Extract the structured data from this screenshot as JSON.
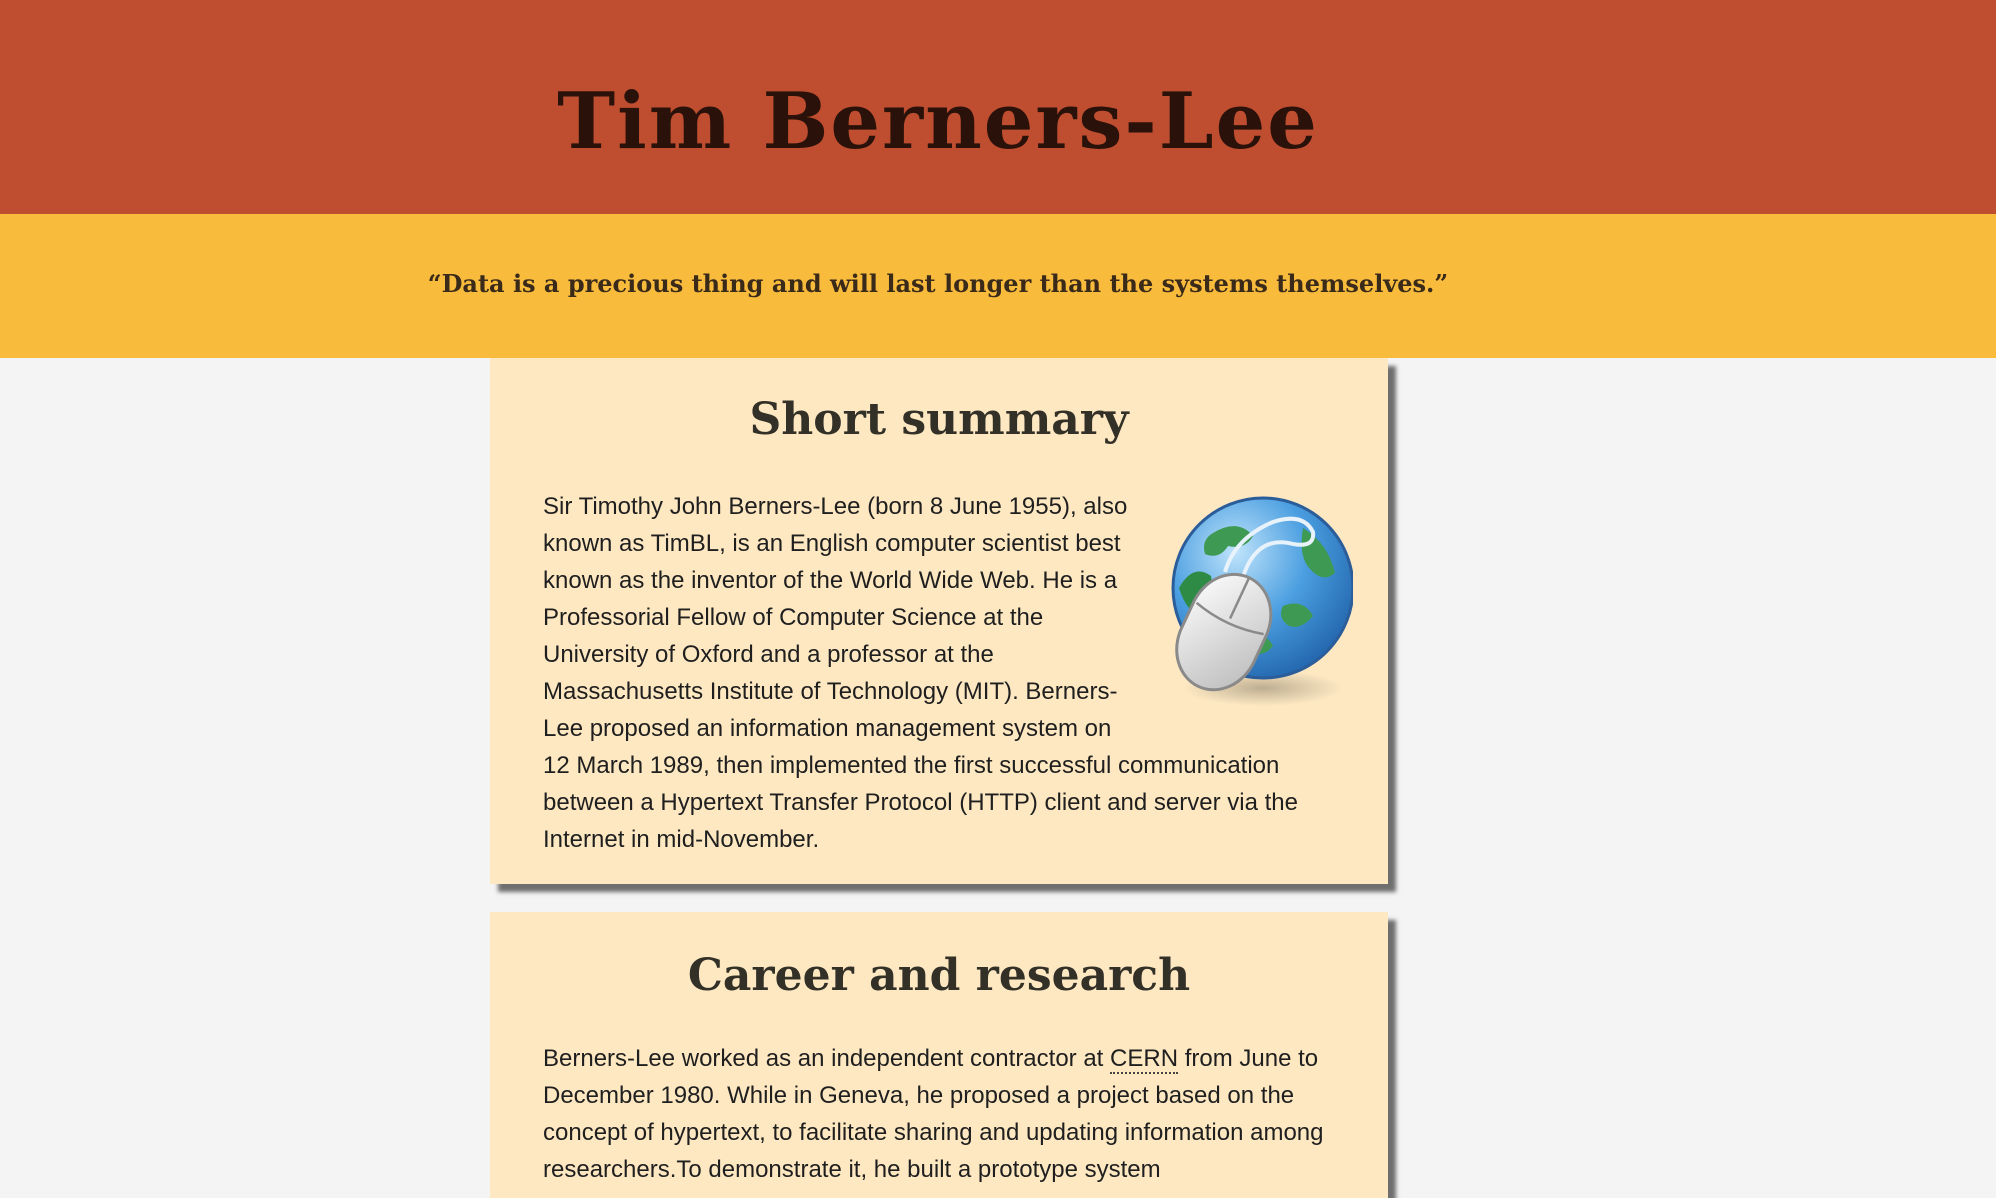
{
  "header": {
    "title": "Tim Berners-Lee",
    "bg_color": "#bf4e30"
  },
  "quote": {
    "text": "“Data is a precious thing and will last longer than the systems themselves.”",
    "bg_color": "#f8bb3c"
  },
  "sections": [
    {
      "heading": "Short summary",
      "image_icon": "globe-with-mouse-icon",
      "body": "Sir Timothy John Berners-Lee (born 8 June 1955), also known as TimBL, is an English computer scientist best known as the inventor of the World Wide Web. He is a Professorial Fellow of Computer Science at the University of Oxford and a professor at the Massachusetts Institute of Technology (MIT). Berners-Lee proposed an information management system on 12 March 1989, then implemented the first successful communication between a Hypertext Transfer Protocol (HTTP) client and server via the Internet in mid-November."
    },
    {
      "heading": "Career and research",
      "body_before": "Berners-Lee worked as an independent contractor at ",
      "abbr": "CERN",
      "body_after": " from June to December 1980. While in Geneva, he proposed a project based on the concept of hypertext, to facilitate sharing and updating information among researchers.To demonstrate it, he built a prototype system"
    }
  ],
  "colors": {
    "card_bg": "#fde8c2",
    "page_bg": "#f4f4f4"
  }
}
